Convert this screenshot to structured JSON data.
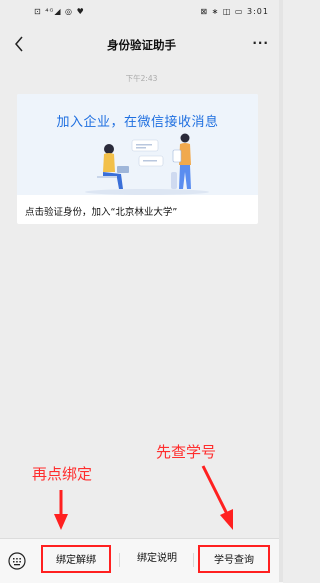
{
  "status_bar": {
    "left_icons": "⊡ ⁴ᴳ◢ ◎ ♥",
    "right_text": "⊠ ∗ ◫ ▭ 3:01"
  },
  "nav": {
    "title": "身份验证助手",
    "more": "···"
  },
  "chat": {
    "timestamp": "下午2:43",
    "card": {
      "banner_title": "加入企业，在微信接收消息",
      "text": "点击验证身份，加入“北京林业大学”"
    }
  },
  "annotations": {
    "lookup_first": "先查学号",
    "then_bind": "再点绑定",
    "color": "#ff2d2d"
  },
  "bottom_menu": {
    "unbind_label": "绑定解绑",
    "help_label": "绑定说明",
    "lookup_label": "学号查询"
  },
  "colors": {
    "accent_blue": "#1f6fe0",
    "highlight_red": "#ff2020"
  }
}
